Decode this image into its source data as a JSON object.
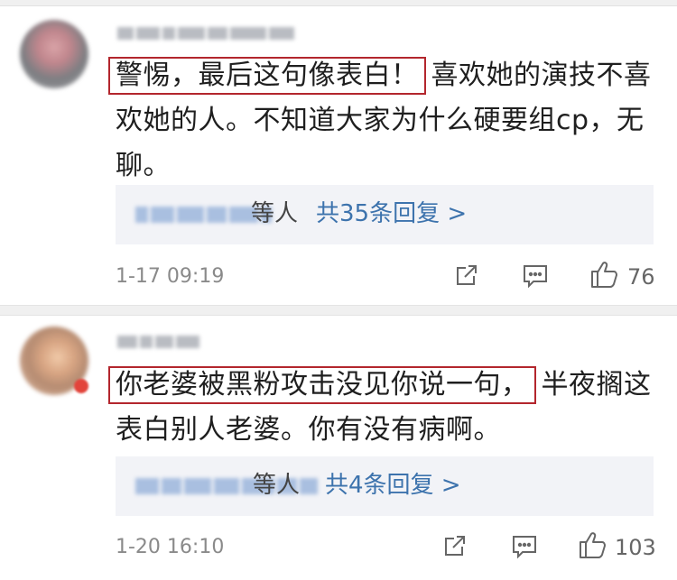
{
  "comments": [
    {
      "highlight": "警惕，最后这句像表白！",
      "body": "喜欢她的演技不喜欢她的人。不知道大家为什么硬要组cp，无聊。",
      "reply_suffix": "等人",
      "reply_link": "共35条回复 >",
      "time": "1-17 09:19",
      "likes": "76"
    },
    {
      "highlight": "你老婆被黑粉攻击没见你说一句，",
      "body": "半夜搁这表白别人老婆。你有没有病啊。",
      "reply_suffix": "等人",
      "reply_link": "共4条回复 >",
      "time": "1-20 16:10",
      "likes": "103"
    }
  ],
  "icons": [
    "share-icon",
    "comment-icon",
    "like-icon"
  ],
  "colors": {
    "highlight_border": "#b3262d",
    "link": "#3d73ad",
    "reply_bg": "#f2f3f7",
    "meta": "#8a8a8a"
  }
}
